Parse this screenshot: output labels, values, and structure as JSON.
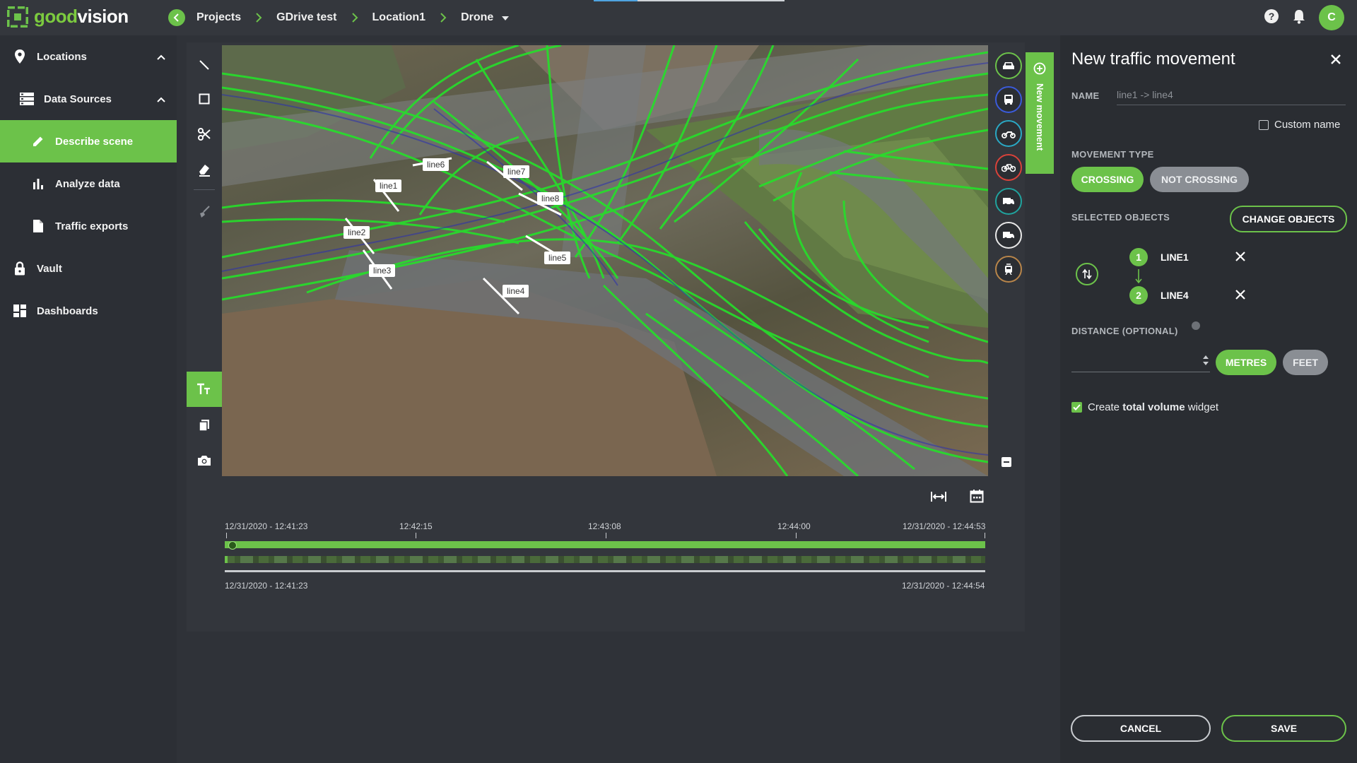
{
  "app": {
    "logo_good": "good",
    "logo_vision": "vision",
    "avatar_letter": "C"
  },
  "breadcrumb": [
    "Projects",
    "GDrive test",
    "Location1",
    "Drone"
  ],
  "sidebar": {
    "items": [
      {
        "label": "Locations",
        "icon": "map-pin-icon"
      },
      {
        "label": "Data Sources",
        "icon": "database-icon"
      },
      {
        "label": "Describe scene",
        "icon": "pencil-icon",
        "active": true
      },
      {
        "label": "Analyze data",
        "icon": "bar-chart-icon"
      },
      {
        "label": "Traffic exports",
        "icon": "file-icon"
      },
      {
        "label": "Vault",
        "icon": "lock-icon"
      },
      {
        "label": "Dashboards",
        "icon": "dashboard-icon"
      }
    ]
  },
  "video": {
    "line_labels": [
      "line1",
      "line2",
      "line3",
      "line4",
      "line5",
      "line6",
      "line7",
      "line8"
    ]
  },
  "new_movement_tab": "New movement",
  "timeline": {
    "ticks": [
      "12/31/2020 - 12:41:23",
      "12:42:15",
      "12:43:08",
      "12:44:00",
      "12/31/2020 - 12:44:53"
    ],
    "range_start": "12/31/2020 - 12:41:23",
    "range_end": "12/31/2020 - 12:44:54"
  },
  "panel": {
    "title": "New traffic movement",
    "name_label": "NAME",
    "name_value": "line1 -> line4",
    "custom_name_label": "Custom name",
    "movement_type_label": "MOVEMENT TYPE",
    "crossing": "CROSSING",
    "not_crossing": "NOT CROSSING",
    "selected_objects_label": "SELECTED OBJECTS",
    "change_objects": "CHANGE OBJECTS",
    "objects": [
      {
        "num": "1",
        "name": "LINE1"
      },
      {
        "num": "2",
        "name": "LINE4"
      }
    ],
    "distance_label": "DISTANCE (OPTIONAL)",
    "metres": "METRES",
    "feet": "FEET",
    "widget_prefix": "Create ",
    "widget_bold": "total volume",
    "widget_suffix": " widget",
    "cancel": "CANCEL",
    "save": "SAVE"
  },
  "colors": {
    "accent": "#6cc24a",
    "background": "#2f3238",
    "panel": "#2a2d32"
  }
}
